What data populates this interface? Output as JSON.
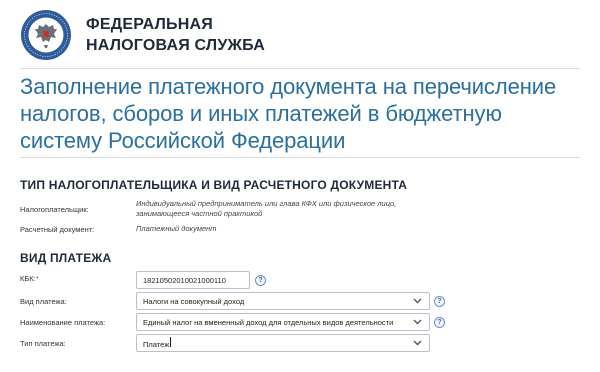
{
  "header": {
    "org_line1": "ФЕДЕРАЛЬНАЯ",
    "org_line2": "НАЛОГОВАЯ СЛУЖБА"
  },
  "page": {
    "title": "Заполнение платежного документа на перечисление налогов, сборов и иных платежей в бюджетную систему Российской Федерации"
  },
  "section1": {
    "title": "ТИП НАЛОГОПЛАТЕЛЬЩИКА И ВИД РАСЧЕТНОГО ДОКУМЕНТА",
    "taxpayer_label": "Налогоплательщик:",
    "taxpayer_value": "Индивидуальный предприниматель или глава КФХ или физическое лицо, занимающееся частной практикой",
    "doc_label": "Расчетный документ:",
    "doc_value": "Платежный документ"
  },
  "section2": {
    "title": "ВИД ПЛАТЕЖА",
    "kbk_label": "КБК:",
    "kbk_required": "*",
    "kbk_value": "18210502010021000110",
    "payment_kind_label": "Вид платежа:",
    "payment_kind_value": "Налоги на совокупный доход",
    "payment_name_label": "Наименование платежа:",
    "payment_name_value": "Единый налог на вмененный доход для отдельных видов деятельности",
    "payment_type_label": "Тип платежа:",
    "payment_type_value": "Платеж"
  },
  "icons": {
    "logo": "fns-emblem",
    "help": "question-circle-icon",
    "dropdown": "chevron-down-icon"
  },
  "colors": {
    "title_blue": "#2a6f9f",
    "help_blue": "#3d69a8"
  }
}
